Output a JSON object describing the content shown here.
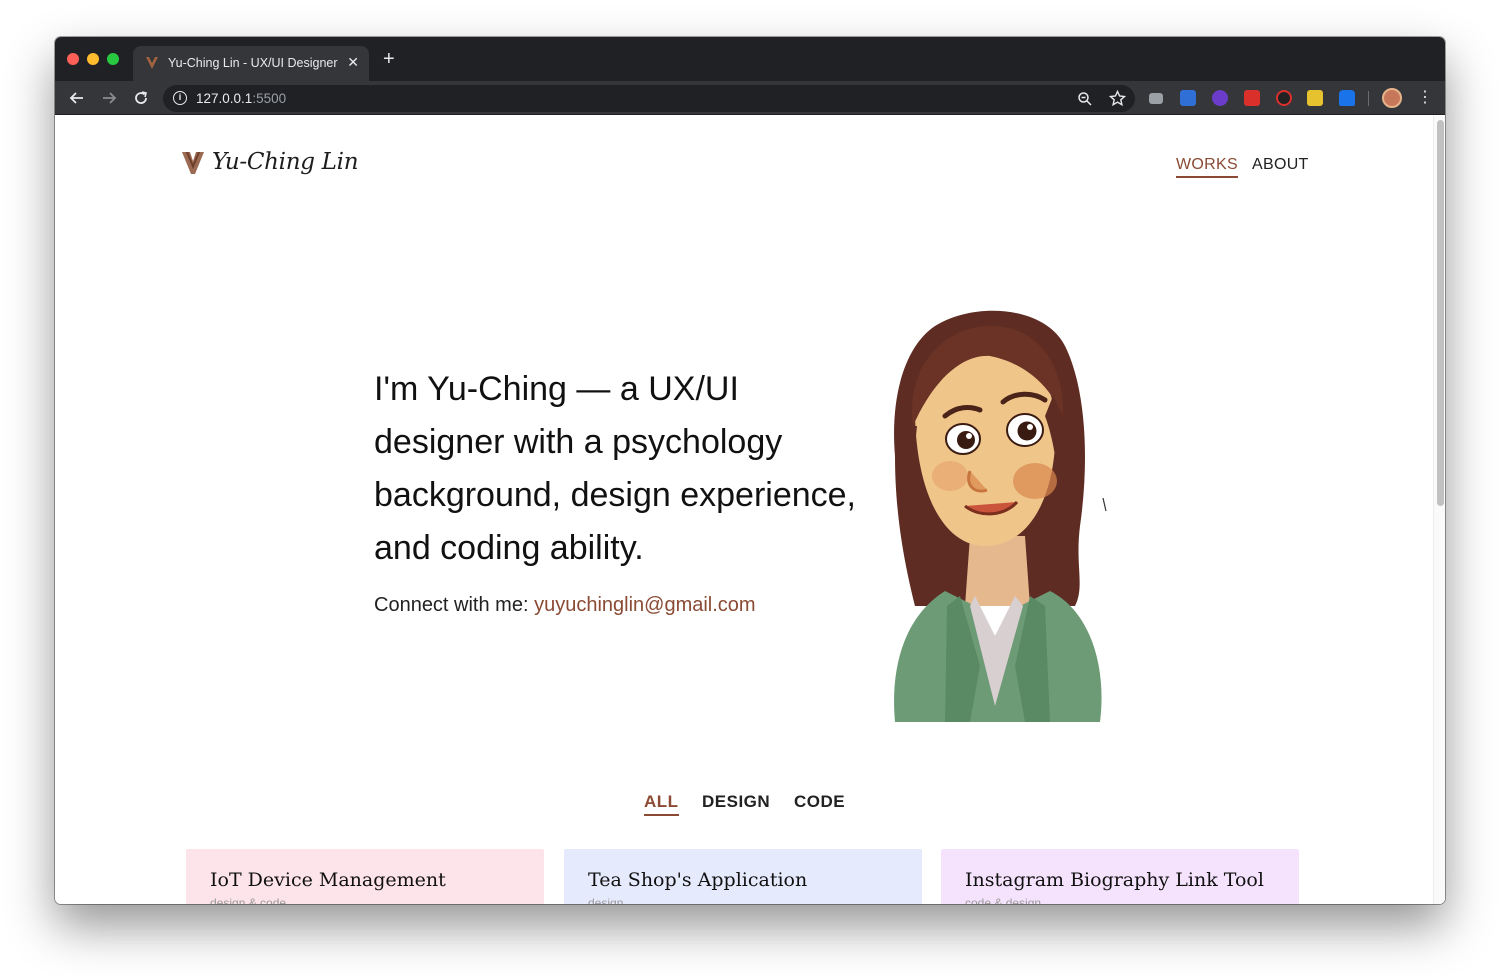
{
  "browser": {
    "tab_title": "Yu-Ching Lin - UX/UI Designer",
    "tab_close_glyph": "✕",
    "new_tab_glyph": "+",
    "url_host": "127.0.0.1",
    "url_port": ":5500",
    "icons": [
      "back-arrow-icon",
      "forward-arrow-icon",
      "reload-icon",
      "info-icon",
      "zoom-icon",
      "star-icon",
      "menu-dots-icon"
    ],
    "extension_colors": [
      "#9aa0a6",
      "#2f6fd6",
      "#6a3cc9",
      "#d9302c",
      "#222222",
      "#e6c22e",
      "#1a73e8"
    ]
  },
  "site": {
    "logo_text": "Yu-Ching Lin",
    "logo_color": "#8a5a44",
    "accent_color": "#8a4a33",
    "nav": {
      "works": "WORKS",
      "about": "ABOUT"
    },
    "hero": {
      "headline": "I'm Yu-Ching — a UX/UI designer with a psychology background, design experience, and coding ability.",
      "connect_label": "Connect with me: ",
      "email": "yuyuchinglin@gmail.com"
    },
    "filters": {
      "all": "ALL",
      "design": "DESIGN",
      "code": "CODE"
    },
    "cards": [
      {
        "title": "IoT Device Management",
        "subtitle": "design & code",
        "color": "#fde3ea"
      },
      {
        "title": "Tea Shop's Application",
        "subtitle": "design",
        "color": "#e6eafd"
      },
      {
        "title": "Instagram Biography Link Tool",
        "subtitle": "code & design",
        "color": "#f5e3fd"
      }
    ]
  }
}
